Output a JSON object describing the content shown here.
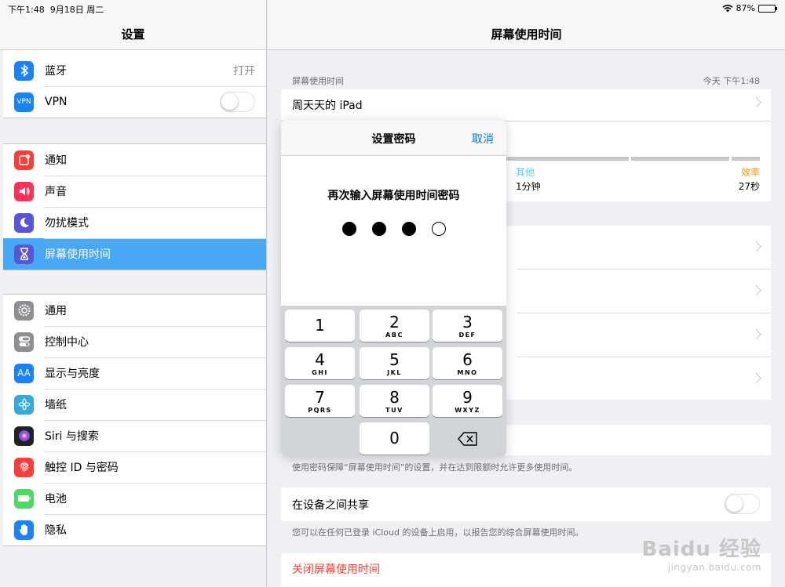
{
  "status": {
    "time": "下午1:48",
    "date": "9月18日 周二",
    "battery": "87%",
    "battery_level": 0.87
  },
  "sidebar": {
    "title": "设置",
    "group1": [
      {
        "name": "bluetooth",
        "label": "蓝牙",
        "value": "打开",
        "icon_color": "#1a82fb",
        "icon": "bluetooth-icon"
      },
      {
        "name": "vpn",
        "label": "VPN",
        "icon_color": "#1a82fb",
        "icon": "vpn-icon",
        "icon_text": "VPN"
      }
    ],
    "group2": [
      {
        "name": "notifications",
        "label": "通知",
        "icon_color": "#fc3d39",
        "icon": "notification-icon"
      },
      {
        "name": "sounds",
        "label": "声音",
        "icon_color": "#fc3158",
        "icon": "speaker-icon"
      },
      {
        "name": "dnd",
        "label": "勿扰模式",
        "icon_color": "#5856d6",
        "icon": "moon-icon"
      },
      {
        "name": "screen-time",
        "label": "屏幕使用时间",
        "icon_color": "#5856d6",
        "icon": "hourglass-icon"
      }
    ],
    "group3": [
      {
        "name": "general",
        "label": "通用",
        "icon_color": "#8e8e93",
        "icon": "gear-icon"
      },
      {
        "name": "control-center",
        "label": "控制中心",
        "icon_color": "#8e8e93",
        "icon": "switches-icon"
      },
      {
        "name": "display",
        "label": "显示与亮度",
        "icon_color": "#1a82fb",
        "icon": "text-size-icon",
        "icon_text": "AA"
      },
      {
        "name": "wallpaper",
        "label": "墙纸",
        "icon_color": "#34aadc",
        "icon": "flower-icon"
      },
      {
        "name": "siri",
        "label": "Siri 与搜索",
        "icon_color": "#222",
        "icon": "siri-icon"
      },
      {
        "name": "touch-id",
        "label": "触控 ID 与密码",
        "icon_color": "#fc3d39",
        "icon": "fingerprint-icon"
      },
      {
        "name": "battery",
        "label": "电池",
        "icon_color": "#4cd964",
        "icon": "battery-icon"
      },
      {
        "name": "privacy",
        "label": "隐私",
        "icon_color": "#1a82fb",
        "icon": "hand-icon"
      }
    ]
  },
  "main": {
    "title": "屏幕使用时间",
    "usage_header": "屏幕使用时间",
    "usage_time": "今天 下午1:48",
    "device": "周天天的 iPad",
    "categories": [
      {
        "label": "其他",
        "value": "1分钟",
        "color": "#5ac8fa"
      },
      {
        "label": "效率",
        "value": "27秒",
        "color": "#ff9500"
      }
    ],
    "passcode_note": "使用密码保障“屏幕使用时间”的设置，并在达到限额时允许更多使用时间。",
    "share_label": "在设备之间共享",
    "share_note": "您可以在任何已登录 iCloud 的设备上启用，以报告您的综合屏幕使用时间。",
    "turn_off": "关闭屏幕使用时间",
    "turn_off_color": "#ff3b30"
  },
  "modal": {
    "title": "设置密码",
    "cancel": "取消",
    "prompt": "再次输入屏幕使用时间密码",
    "digits_entered": 3,
    "digits_total": 4,
    "keys": [
      {
        "num": "1",
        "letters": ""
      },
      {
        "num": "2",
        "letters": "ABC"
      },
      {
        "num": "3",
        "letters": "DEF"
      },
      {
        "num": "4",
        "letters": "GHI"
      },
      {
        "num": "5",
        "letters": "JKL"
      },
      {
        "num": "6",
        "letters": "MNO"
      },
      {
        "num": "7",
        "letters": "PQRS"
      },
      {
        "num": "8",
        "letters": "TUV"
      },
      {
        "num": "9",
        "letters": "WXYZ"
      },
      {
        "num": "0",
        "letters": ""
      }
    ]
  },
  "watermark": {
    "brand": "Baidu 经验",
    "url": "jingyan.baidu.com"
  }
}
